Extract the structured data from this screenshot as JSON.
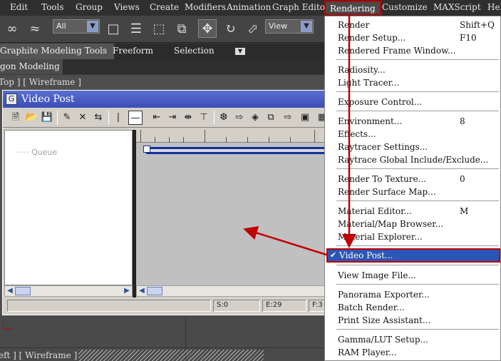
{
  "menubar": {
    "items": [
      "Edit",
      "Tools",
      "Group",
      "Views",
      "Create",
      "Modifiers",
      "Animation",
      "Graph Editors",
      "Rendering",
      "Customize",
      "MAXScript",
      "Help"
    ],
    "active": "Rendering"
  },
  "toolbar": {
    "selection_filter": "All",
    "reference_coord": "View"
  },
  "ribbon": {
    "tabs": [
      "Graphite Modeling Tools",
      "Freeform",
      "Selection"
    ],
    "sub_label": "gon Modeling"
  },
  "viewports": {
    "top_label": "Top ] [ Wireframe ]",
    "bottom_label": "eft ] [ Wireframe ]"
  },
  "video_post": {
    "title": "Video Post",
    "queue_label": "Queue",
    "status": {
      "start": "S:0",
      "end": "E:29",
      "frames": "F:3"
    }
  },
  "rendering_menu": {
    "groups": [
      [
        {
          "label": "Render",
          "shortcut": "Shift+Q"
        },
        {
          "label": "Render Setup...",
          "shortcut": "F10"
        },
        {
          "label": "Rendered Frame Window...",
          "shortcut": ""
        }
      ],
      [
        {
          "label": "Radiosity...",
          "shortcut": ""
        },
        {
          "label": "Light Tracer...",
          "shortcut": ""
        }
      ],
      [
        {
          "label": "Exposure Control...",
          "shortcut": ""
        }
      ],
      [
        {
          "label": "Environment...",
          "shortcut": "8"
        },
        {
          "label": "Effects...",
          "shortcut": ""
        },
        {
          "label": "Raytracer Settings...",
          "shortcut": ""
        },
        {
          "label": "Raytrace Global Include/Exclude...",
          "shortcut": ""
        }
      ],
      [
        {
          "label": "Render To Texture...",
          "shortcut": "0"
        },
        {
          "label": "Render Surface Map...",
          "shortcut": ""
        }
      ],
      [
        {
          "label": "Material Editor...",
          "shortcut": "M"
        },
        {
          "label": "Material/Map Browser...",
          "shortcut": ""
        },
        {
          "label": "Material Explorer...",
          "shortcut": ""
        }
      ],
      [
        {
          "label": "Video Post...",
          "shortcut": "",
          "checked": true,
          "highlighted": true
        }
      ],
      [
        {
          "label": "View Image File...",
          "shortcut": ""
        }
      ],
      [
        {
          "label": "Panorama Exporter...",
          "shortcut": ""
        },
        {
          "label": "Batch Render...",
          "shortcut": ""
        },
        {
          "label": "Print Size Assistant...",
          "shortcut": ""
        }
      ],
      [
        {
          "label": "Gamma/LUT Setup...",
          "shortcut": ""
        },
        {
          "label": "RAM Player...",
          "shortcut": ""
        }
      ]
    ]
  },
  "colors": {
    "annotation": "#c00000",
    "highlight": "#2b55b6",
    "window_title": "#3a4db8"
  }
}
